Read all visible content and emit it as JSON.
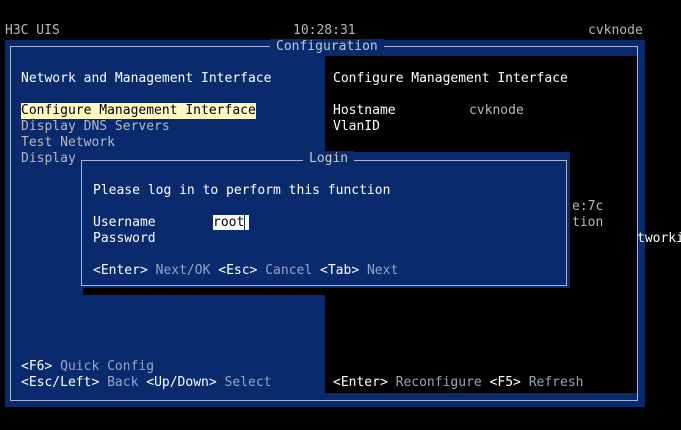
{
  "header": {
    "product": "H3C UIS",
    "time": "10:28:31",
    "host": "cvknode"
  },
  "window": {
    "title": "Configuration"
  },
  "left_pane": {
    "heading": "Network and Management Interface",
    "items": [
      {
        "label": "Configure Management Interface",
        "selected": true
      },
      {
        "label": "Display DNS Servers"
      },
      {
        "label": "Test Network"
      },
      {
        "label": "Display"
      }
    ],
    "footer": [
      {
        "key": "<F6>",
        "action": "Quick Config"
      },
      {
        "key": "<Esc/Left>",
        "action": "Back"
      },
      {
        "key": "<Up/Down>",
        "action": "Select"
      }
    ]
  },
  "right_pane": {
    "heading": "Configure Management Interface",
    "hostname_label": "Hostname",
    "hostname_value": "cvknode",
    "vlan_label": "VlanID",
    "peek_1": "e:7c",
    "peek_2": "tion",
    "peek_3": "tworki",
    "footer": [
      {
        "key": "<Enter>",
        "action": "Reconfigure"
      },
      {
        "key": "<F5>",
        "action": "Refresh"
      }
    ]
  },
  "login": {
    "title": "Login",
    "prompt": "Please log in to perform this function",
    "username_label": "Username",
    "username_value": "root",
    "password_label": "Password",
    "hints": [
      {
        "key": "<Enter>",
        "action": "Next/OK"
      },
      {
        "key": "<Esc>",
        "action": "Cancel"
      },
      {
        "key": "<Tab>",
        "action": "Next"
      }
    ]
  }
}
